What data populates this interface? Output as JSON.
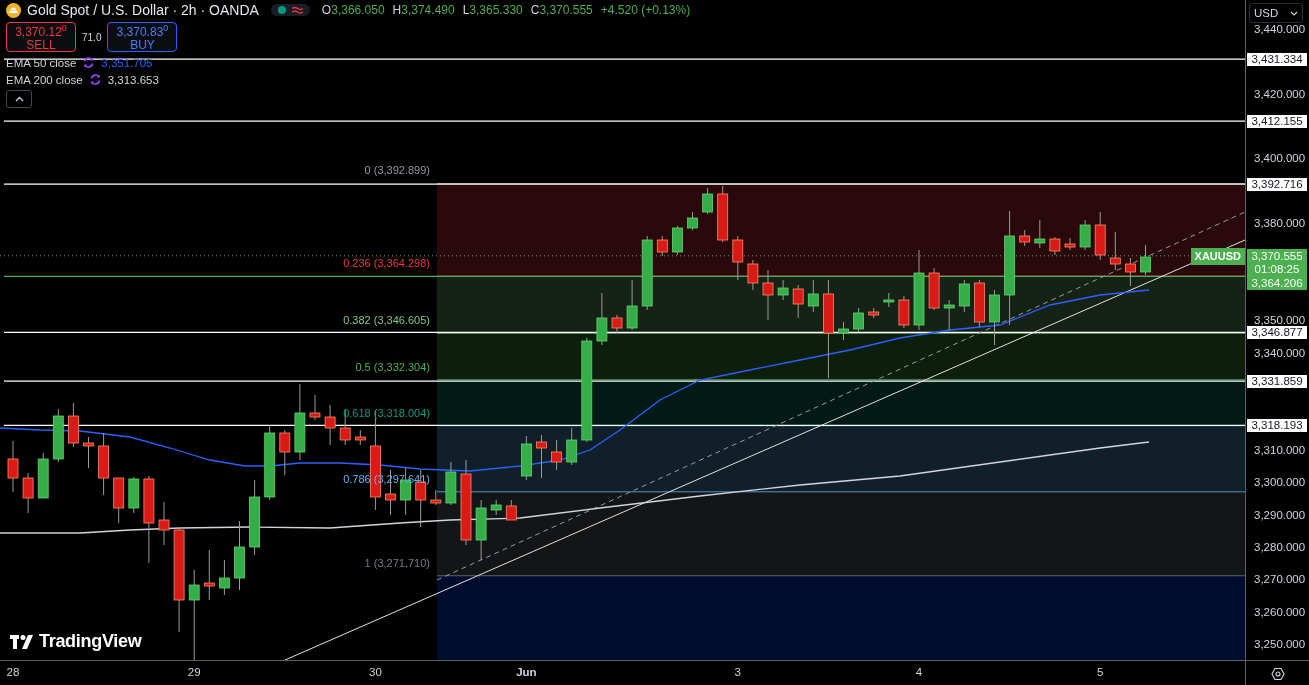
{
  "header": {
    "title": "Gold Spot / U.S. Dollar · 2h · OANDA",
    "ohlc": [
      {
        "label": "O",
        "value": "3,366.050"
      },
      {
        "label": "H",
        "value": "3,374.490"
      },
      {
        "label": "L",
        "value": "3,365.330"
      },
      {
        "label": "C",
        "value": "3,370.555"
      }
    ],
    "change": "+4.520 (+0.13%)"
  },
  "trade": {
    "sell": {
      "price": "3,370.12$^{0}$",
      "label": "SELL"
    },
    "spread": "71.0",
    "buy": {
      "price": "3,370.83$^{0}$",
      "label": "BUY"
    }
  },
  "indicators": [
    {
      "name": "EMA 50 close",
      "value": "3,351.705",
      "color": "#2962ff"
    },
    {
      "name": "EMA 200 close",
      "value": "3,313.653",
      "color": "#d1d4dc"
    }
  ],
  "fib_levels": [
    {
      "label": "0 (3,392.899)",
      "color": "#9598a1"
    },
    {
      "label": "0.236 (3,364.298)",
      "color": "#f23645"
    },
    {
      "label": "0.382 (3,346.605)",
      "color": "#81c784"
    },
    {
      "label": "0.5 (3,332.304)",
      "color": "#4caf50"
    },
    {
      "label": "0.618 (3,318.004)",
      "color": "#089981"
    },
    {
      "label": "0.786 (3,297.641)",
      "color": "#64b5f6"
    },
    {
      "label": "1 (3,271.710)",
      "color": "#787b86"
    }
  ],
  "price_axis": {
    "currency": "USD",
    "ticks": [
      "3,440.000",
      "3,420.000",
      "3,400.000",
      "3,380.000",
      "3,350.000",
      "3,340.000",
      "3,310.000",
      "3,300.000",
      "3,290.000",
      "3,280.000",
      "3,270.000",
      "3,260.000",
      "3,250.000"
    ]
  },
  "price_badges": [
    {
      "kind": "line",
      "value": "3,431.334",
      "color": "#ffffff"
    },
    {
      "kind": "line",
      "value": "3,412.155",
      "color": "#ffffff"
    },
    {
      "kind": "line",
      "value": "3,392.716",
      "color": "#ffffff"
    },
    {
      "kind": "last",
      "value": "3,370.555",
      "countdown": "01:08:25",
      "color": "#4caf50"
    },
    {
      "kind": "line",
      "value": "3,364.206",
      "color": "#4caf50"
    },
    {
      "kind": "line",
      "value": "3,346.877",
      "color": "#ffffff"
    },
    {
      "kind": "line",
      "value": "3,331.859",
      "color": "#ffffff"
    },
    {
      "kind": "line",
      "value": "3,318.193",
      "color": "#ffffff"
    }
  ],
  "symbol_tag": "XAUUSD",
  "time_axis": [
    {
      "label": "28",
      "kind": "day"
    },
    {
      "label": "29",
      "kind": "day"
    },
    {
      "label": "30",
      "kind": "day"
    },
    {
      "label": "Jun",
      "kind": "month"
    },
    {
      "label": "3",
      "kind": "day"
    },
    {
      "label": "4",
      "kind": "day"
    },
    {
      "label": "5",
      "kind": "day"
    }
  ],
  "logo": "TradingView"
}
